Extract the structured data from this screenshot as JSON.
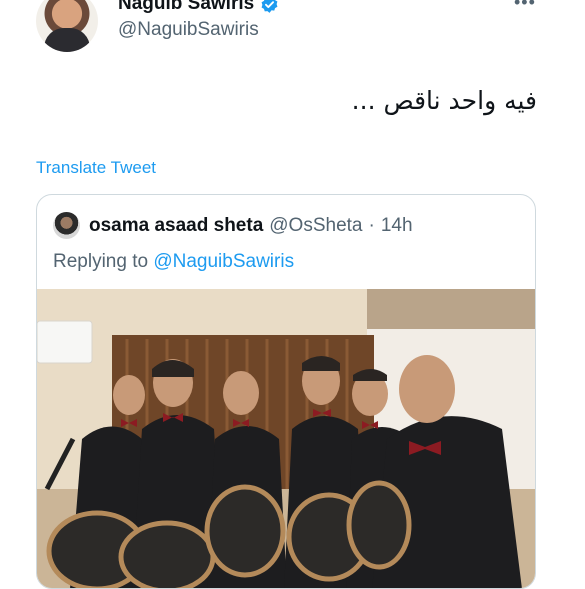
{
  "tweet": {
    "display_name": "Naguib Sawiris",
    "handle": "@NaguibSawiris",
    "text": "فيه واحد ناقص ...",
    "translate_label": "Translate Tweet",
    "verified_icon": "verified-badge-icon",
    "more_icon": "more-options-icon"
  },
  "quoted": {
    "display_name": "osama asaad sheta",
    "handle": "@OsSheta",
    "separator": "·",
    "time": "14h",
    "replying_prefix": "Replying to",
    "replying_to": "@NaguibSawiris"
  },
  "colors": {
    "link": "#1d9bf0",
    "muted": "#536471",
    "border": "#cfd9de"
  }
}
